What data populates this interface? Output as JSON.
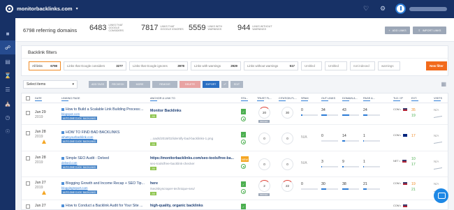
{
  "app": {
    "domain": "monitorbacklinks.com"
  },
  "header": {
    "referring_domains": "6798 referring domains",
    "stats": [
      {
        "value": "6483",
        "label": "LINKS THAT GOOGLE CONSIDERS"
      },
      {
        "value": "7817",
        "label": "LINKS THAT GOOGLE IGNORES"
      },
      {
        "value": "5559",
        "label": "LINKS WITH WARNINGS"
      },
      {
        "value": "944",
        "label": "LINKS WITHOUT WARNINGS"
      }
    ],
    "add_links": "ADD LINKS",
    "import_links": "IMPORT LINKS"
  },
  "filters": {
    "title": "Backlink filters",
    "chips": [
      {
        "label": "All links",
        "count": "6798"
      },
      {
        "label": "Links that Google considers",
        "count": "3277"
      },
      {
        "label": "Links that Google ignores",
        "count": "3978"
      },
      {
        "label": "Links with warnings",
        "count": "2929"
      },
      {
        "label": "Links without warnings",
        "count": "517"
      }
    ],
    "custom": [
      "Untitled",
      "Untitled",
      "not indexed",
      "warnings"
    ],
    "new_filter": "New filter"
  },
  "toolbar": {
    "select": "Select items",
    "buttons": [
      "ADD TAGS",
      "RECHECK",
      "MORE",
      "REMOVE",
      "DELETE",
      "EXPORT",
      "",
      "EDIT"
    ]
  },
  "table": {
    "columns": [
      "DATE",
      "LINKING PAGE",
      "ANCHOR & LINK TO",
      "STA...",
      "TRUST FL...",
      "CITATION FL...",
      "SPAM",
      "OUT LINKS",
      "DOMAIN A...",
      "PAGE A...",
      "TLD / IP",
      "EXT.",
      "VISITS"
    ],
    "rows": [
      {
        "date": "Jun 29",
        "year": "2019",
        "title": "How to Build a Scalable Link Building Process:...",
        "source": "blogspot.com",
        "tags": [
          "AUTO-ONE CLICKS",
          "BACKLINKS"
        ],
        "anchor": "Monitor Backlinks",
        "path": "",
        "gtag": "200",
        "status": "✓",
        "trust": "20",
        "trust_badge": "BROKEN",
        "citation": "30",
        "spam": "0",
        "out_links": "34",
        "domain_authority": "43",
        "page_authority": "24",
        "tld": "COM • ",
        "ext": "35",
        "ext2": "19",
        "visits": "N/A"
      },
      {
        "date": "Jun 28",
        "year": "2019",
        "title": "HOW TO FIND BAD BACKLINKS",
        "source": "whatsyourbacklink.com",
        "tags": [
          "AUTO-ONE CLICKS",
          "BACKLINKS"
        ],
        "anchor": "",
        "path": "...oads/2018/02/identify-bad-backlinks-1.png",
        "gtag": "200",
        "status": "✓",
        "trust": "0",
        "trust_badge": "",
        "citation": "0",
        "spam": "N/A",
        "out_links": "0",
        "domain_authority": "14",
        "page_authority": "1",
        "tld": "COM • ",
        "ext": "17",
        "ext2": "",
        "visits": "N/A"
      },
      {
        "date": "Jun 28",
        "year": "2019",
        "title": "Simple SEO Audit - Delved",
        "source": "delved.com",
        "tags": [
          "AUTO-ONE CLICKS",
          "BACKLINKS"
        ],
        "anchor": "https://monitorbacklinks.com/seo-tools/free-ba...",
        "path": "seo-tools/free-backlink-checker",
        "gtag": "200",
        "status": "NEW",
        "trust": "0",
        "trust_badge": "",
        "citation": "0",
        "spam": "N/A",
        "out_links": "3",
        "domain_authority": "9",
        "page_authority": "1",
        "tld": "NET • ",
        "ext": "10",
        "ext2": "17",
        "visits": "N/A"
      },
      {
        "date": "Jun 27",
        "year": "2019",
        "title": "Blogging Growth and Income Recap + SEO Tip...",
        "source": "bloggingreport.com",
        "tags": [
          "AUTO-ONE CLICKS",
          "BACKLINKS"
        ],
        "anchor": "here",
        "path": "/seo/skyscraper-technique-seo/",
        "gtag": "200",
        "status": "✓",
        "trust": "2",
        "trust_badge": "BROKEN",
        "citation": "22",
        "spam": "0",
        "out_links": "30",
        "domain_authority": "38",
        "page_authority": "21",
        "tld": "COM • ",
        "ext": "19",
        "ext2": "21",
        "visits": "N/A"
      },
      {
        "date": "Jun 27",
        "year": "2019",
        "title": "How to Conduct a Backlink Audit for Your Site ...",
        "source": "",
        "tags": [],
        "anchor": "high-quality, organic backlinks",
        "path": "",
        "gtag": "",
        "status": "✓",
        "trust": "",
        "trust_badge": "",
        "citation": "",
        "spam": "",
        "out_links": "",
        "domain_authority": "",
        "page_authority": "",
        "tld": "COM • ",
        "ext": "",
        "ext2": "",
        "visits": ""
      }
    ]
  }
}
